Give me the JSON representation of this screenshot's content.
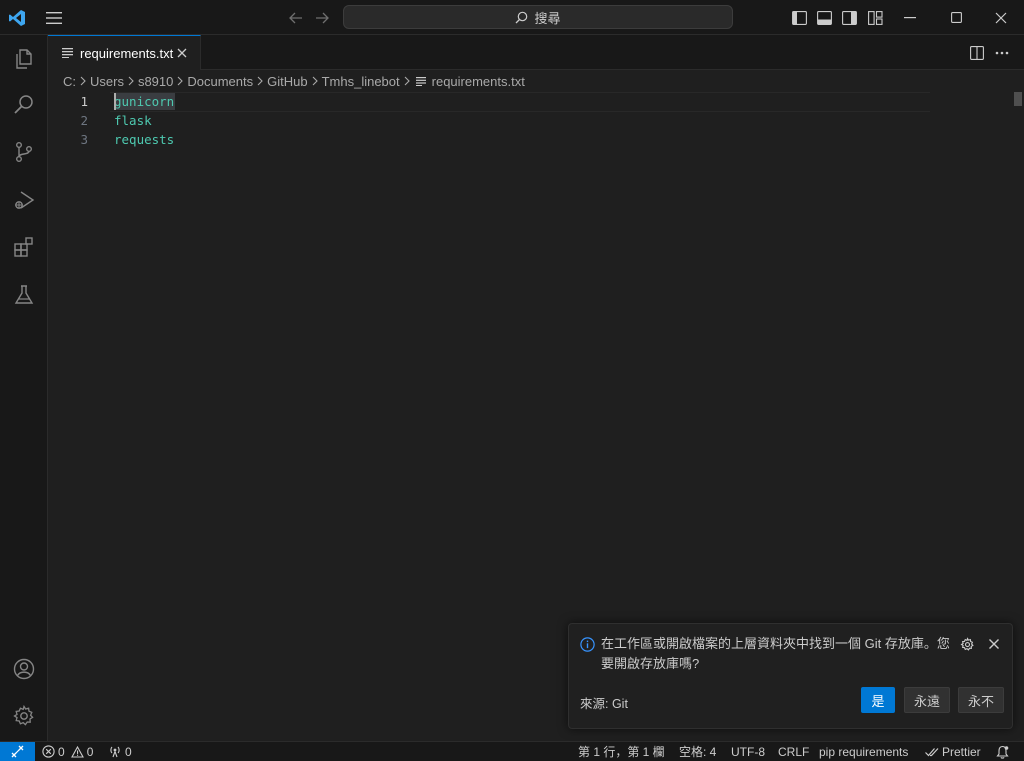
{
  "titlebar": {
    "search_label": "搜尋"
  },
  "tab": {
    "label": "requirements.txt"
  },
  "breadcrumb": [
    "C:",
    "Users",
    "s8910",
    "Documents",
    "GitHub",
    "Tmhs_linebot",
    "requirements.txt"
  ],
  "editor": {
    "line_numbers": [
      "1",
      "2",
      "3"
    ],
    "lines": [
      "gunicorn",
      "flask",
      "requests"
    ],
    "active_line": 1
  },
  "notification": {
    "message": "在工作區或開啟檔案的上層資料夾中找到一個 Git 存放庫。您要開啟存放庫嗎?",
    "source": "來源: Git",
    "buttons": [
      "是",
      "永遠",
      "永不"
    ]
  },
  "statusbar": {
    "errors": "0",
    "warnings": "0",
    "ports": "0",
    "position": "第 1 行，第 1 欄",
    "spaces": "空格: 4",
    "encoding": "UTF-8",
    "eol": "CRLF",
    "language": "pip requirements",
    "formatter": "Prettier"
  },
  "colors": {
    "accent": "#0078d4",
    "code_text": "#4ec9b0",
    "background": "#1f1f1f"
  }
}
